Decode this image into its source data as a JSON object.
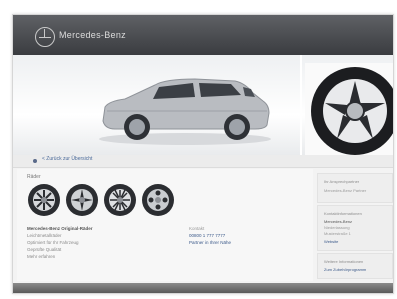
{
  "header": {
    "brand": "Mercedes-Benz",
    "logo_icon": "three-pointed-star-icon",
    "colors": {
      "bar": "#4a4c50",
      "accent_link": "#3c5a8a"
    }
  },
  "hero": {
    "car_image": "suv-side-view",
    "wheel_image": "alloy-wheel-closeup"
  },
  "breadcrumb": {
    "link": "< Zurück zur Übersicht"
  },
  "main": {
    "section_title": "Räder",
    "wheels": [
      "wheel-style-1",
      "wheel-style-2",
      "wheel-style-3",
      "wheel-style-4"
    ],
    "details": {
      "heading": "Mercedes-Benz Original-Räder",
      "lines": [
        "Leichtmetallräder",
        "Optimiert für Ihr Fahrzeug",
        "Geprüfte Qualität",
        "Mehr erfahren"
      ]
    },
    "info": {
      "label": "Kontakt",
      "phone": "00800 1 777 7777",
      "link": "Partner in Ihrer Nähe"
    }
  },
  "sidebar": {
    "box1": {
      "title": "Ihr Ansprechpartner",
      "text": "Mercedes-Benz Partner"
    },
    "box2": {
      "title": "Kontaktinformationen",
      "lines": [
        "Mercedes-Benz",
        "Niederlassung",
        "Musterstraße 1"
      ],
      "link": "Website"
    },
    "box3": {
      "title": "Weitere Informationen",
      "link": "Zum Zubehörprogramm"
    }
  }
}
